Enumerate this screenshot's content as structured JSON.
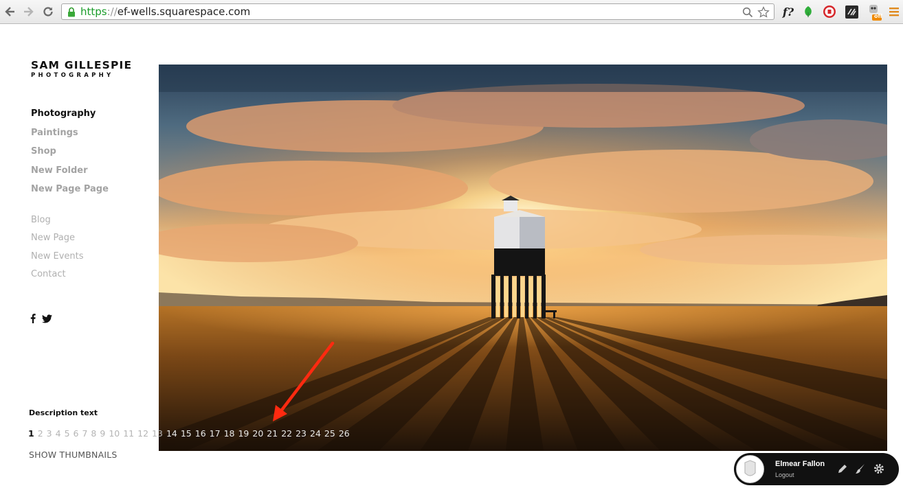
{
  "browser": {
    "back_icon": "back-arrow-icon",
    "forward_icon": "forward-arrow-icon",
    "reload_icon": "reload-icon",
    "url_scheme": "https",
    "url_sep": "://",
    "url_host": "ef-wells.squarespace.com",
    "extension_label": "f?",
    "badge_label": "off"
  },
  "site": {
    "logo_title": "SAM GILLESPIE",
    "logo_subtitle": "PHOTOGRAPHY",
    "nav_primary": [
      "Photography",
      "Paintings",
      "Shop",
      "New Folder",
      "New Page Page"
    ],
    "nav_secondary": [
      "Blog",
      "New Page",
      "New Events",
      "Contact"
    ],
    "social": [
      "facebook-icon",
      "twitter-icon"
    ],
    "description": "Description text",
    "pages": [
      "1",
      "2",
      "3",
      "4",
      "5",
      "6",
      "7",
      "8",
      "9",
      "10",
      "11",
      "12",
      "13",
      "14",
      "15",
      "16",
      "17",
      "18",
      "19",
      "20",
      "21",
      "22",
      "23",
      "24",
      "25",
      "26"
    ],
    "current_page": "1",
    "show_thumbnails": "SHOW THUMBNAILS"
  },
  "userbar": {
    "name": "Elmear Fallon",
    "logout": "Logout",
    "icons": [
      "pencil-icon",
      "brush-icon",
      "gear-icon"
    ]
  },
  "colors": {
    "url_green": "#1a9c2a",
    "nav_active": "#111111",
    "nav_inactive": "#a3a3a3",
    "annotation_arrow": "#ff2a10"
  }
}
